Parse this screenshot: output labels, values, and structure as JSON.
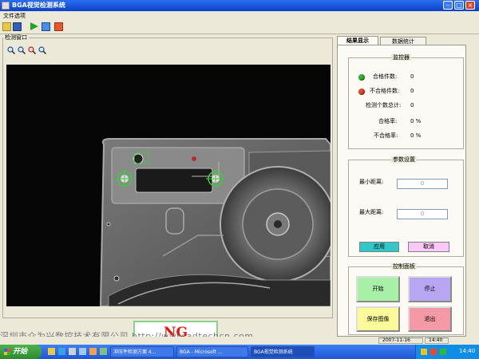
{
  "window": {
    "title": "BGA视觉检测系统"
  },
  "menu": {
    "items": [
      "文件选项"
    ]
  },
  "detection_panel": {
    "title": "检测窗口"
  },
  "tabs": [
    {
      "label": "结果显示",
      "active": true
    },
    {
      "label": "数据统计",
      "active": false
    }
  ],
  "monitor": {
    "title": "监控器",
    "rows": [
      {
        "label": "合格件数:",
        "value": "0",
        "indicator": "green"
      },
      {
        "label": "不合格件数:",
        "value": "0",
        "indicator": "red"
      },
      {
        "label": "检测个数总计:",
        "value": "0"
      },
      {
        "label": "合格率:",
        "value": "0 %"
      },
      {
        "label": "不合格率:",
        "value": "0 %"
      }
    ]
  },
  "params": {
    "title": "参数设置",
    "min_label": "最小距离:",
    "min_value": "0",
    "max_label": "最大距离:",
    "max_value": "0",
    "apply_label": "应用",
    "cancel_label": "取消"
  },
  "control": {
    "title": "控制面板",
    "start_label": "开始",
    "stop_label": "停止",
    "save_label": "保存图像",
    "exit_label": "退出"
  },
  "result": {
    "text": "NG"
  },
  "watermark": "深圳市众为兴数控技术有限公司 http://www.adtechcn.com",
  "status": {
    "date": "2007-11-16",
    "time": "14:40"
  },
  "taskbar": {
    "start_label": "开始",
    "tasks": [
      "冲压件检测方案 4...",
      "BGA - Microsoft ...",
      "BGA视觉检测系统"
    ],
    "clock": "14:40"
  },
  "colors": {
    "accent_ok": "#33b833",
    "accent_ng": "#e8120c",
    "start_btn": "#a8f0a8",
    "stop_btn": "#b9a6f2",
    "save_btn": "#fbfb9c",
    "exit_btn": "#f39aa6"
  },
  "icons": [
    "open-folder-icon",
    "save-icon",
    "run-icon",
    "pause-icon",
    "stop-icon",
    "zoom-in-icon",
    "zoom-out-icon",
    "zoom-fit-icon",
    "zoom-icon"
  ]
}
